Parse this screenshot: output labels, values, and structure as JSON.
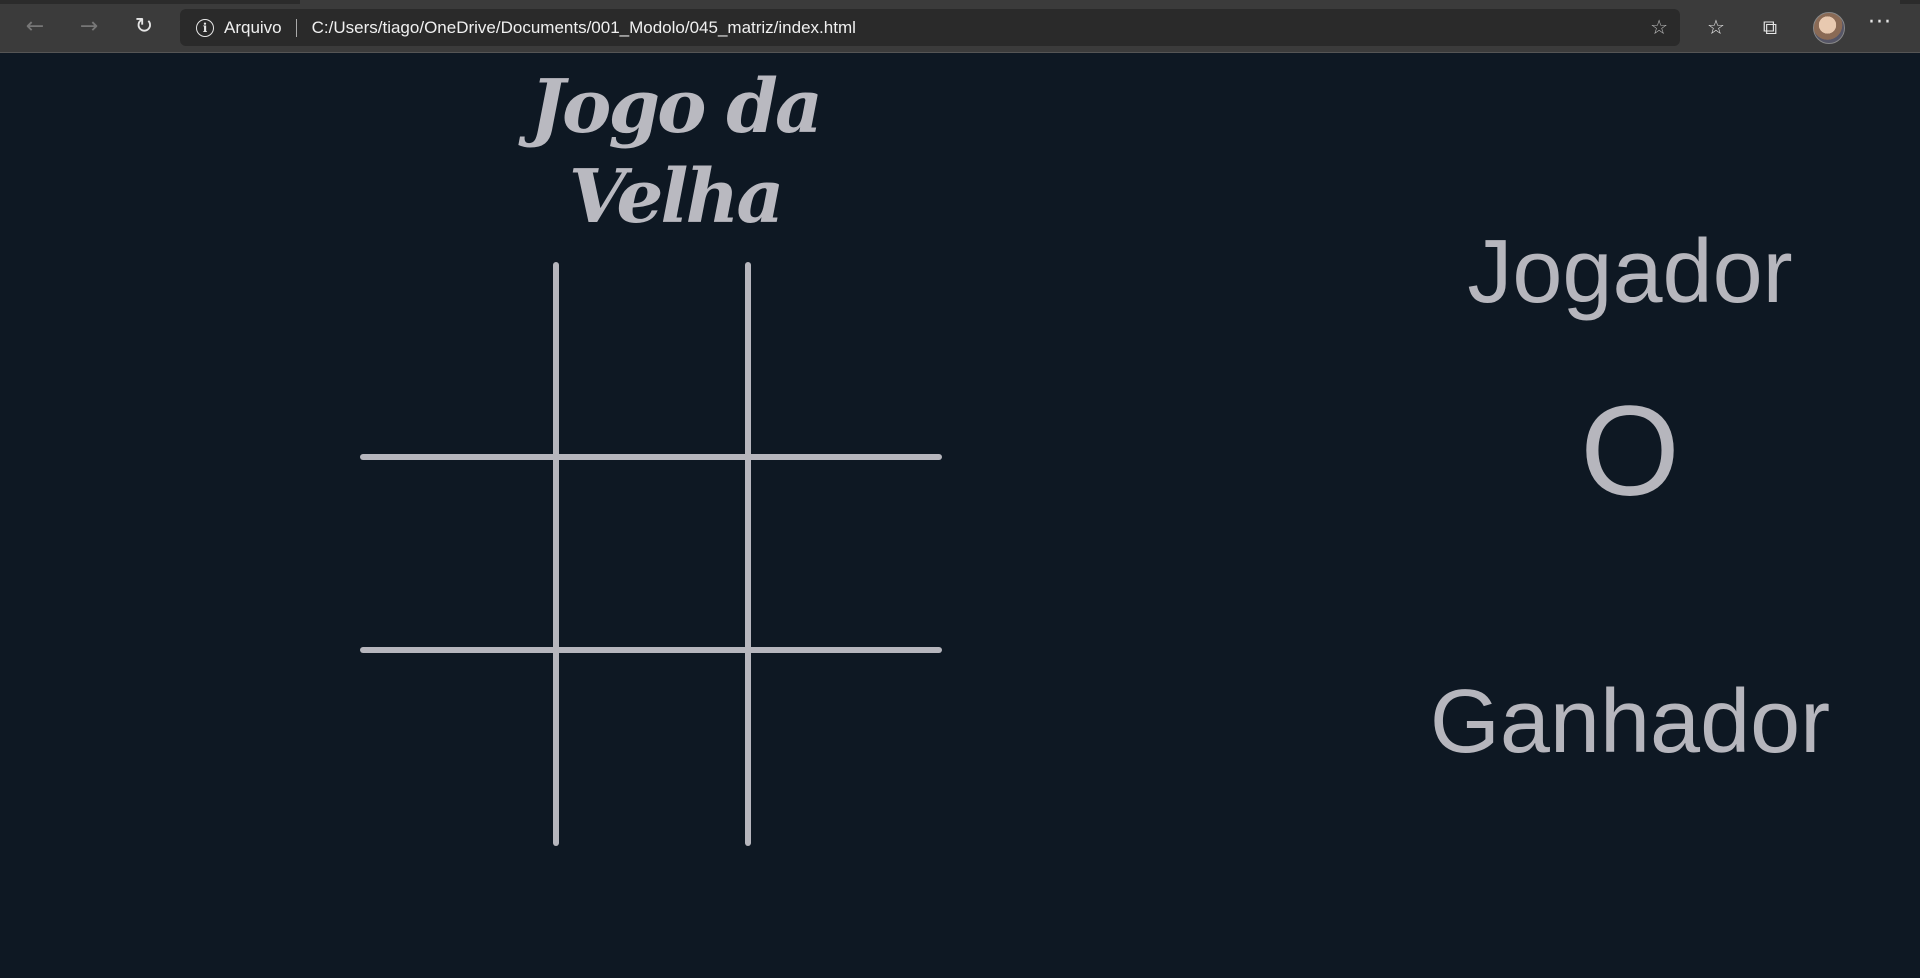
{
  "browser": {
    "site_label": "Arquivo",
    "url": "C:/Users/tiago/OneDrive/Documents/001_Modolo/045_matriz/index.html",
    "icons": {
      "back": "arrow-left",
      "forward": "arrow-right",
      "refresh": "refresh",
      "info": "info-circle",
      "add_favorite": "star-plus",
      "favorites": "favorites-list",
      "collections": "collections",
      "profile": "avatar",
      "more": "ellipsis"
    }
  },
  "page": {
    "title": "Jogo da Velha",
    "player_label": "Jogador",
    "current_player": "O",
    "winner_label": "Ganhador",
    "board": [
      "",
      "",
      "",
      "",
      "",
      "",
      "",
      "",
      ""
    ]
  },
  "colors": {
    "background": "#0e1823",
    "text": "#b6b6bd",
    "grid": "#b6b6bd"
  }
}
